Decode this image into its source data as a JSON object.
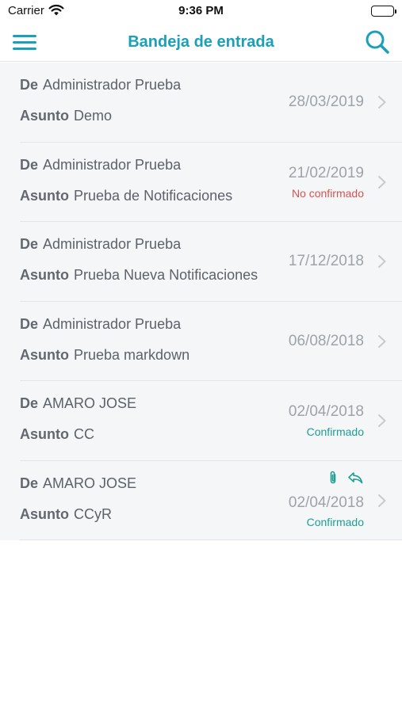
{
  "status_bar": {
    "carrier": "Carrier",
    "time": "9:36 PM"
  },
  "nav": {
    "title": "Bandeja de entrada"
  },
  "labels": {
    "from": "De",
    "subject": "Asunto"
  },
  "colors": {
    "accent": "#1aa0b9",
    "unconfirmed": "#d9534f",
    "confirmed": "#1f9e92"
  },
  "messages": [
    {
      "from": "Administrador Prueba",
      "subject": "Demo",
      "date": "28/03/2019",
      "status": "",
      "status_type": ""
    },
    {
      "from": "Administrador Prueba",
      "subject": "Prueba de Notificaciones",
      "date": "21/02/2019",
      "status": "No confirmado",
      "status_type": "unconfirmed"
    },
    {
      "from": "Administrador Prueba",
      "subject": "Prueba Nueva Notificaciones",
      "date": "17/12/2018",
      "status": "",
      "status_type": ""
    },
    {
      "from": "Administrador Prueba",
      "subject": "Prueba markdown",
      "date": "06/08/2018",
      "status": "",
      "status_type": ""
    },
    {
      "from": "AMARO JOSE",
      "subject": "CC",
      "date": "02/04/2018",
      "status": "Confirmado",
      "status_type": "confirmed"
    },
    {
      "from": "AMARO JOSE",
      "subject": "CCyR",
      "date": "02/04/2018",
      "status": "Confirmado",
      "status_type": "confirmed",
      "icons": [
        "paperclip-icon",
        "reply-icon"
      ]
    }
  ]
}
